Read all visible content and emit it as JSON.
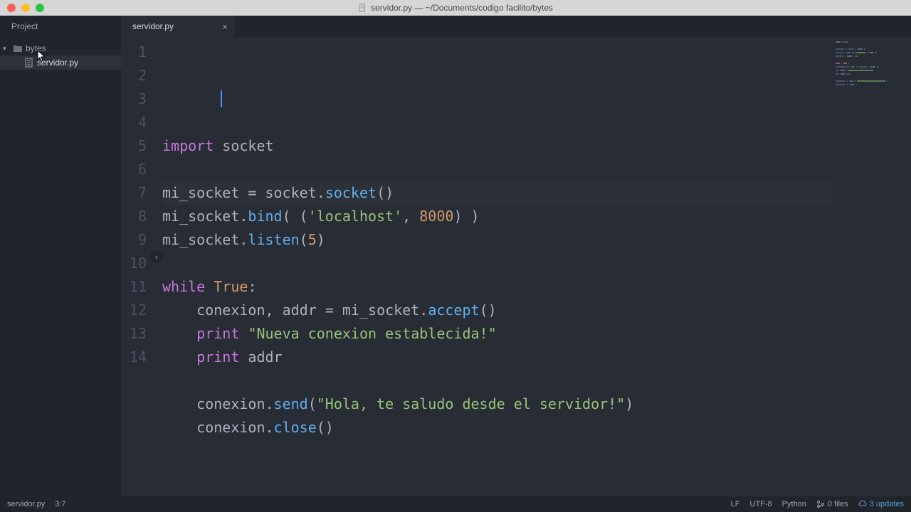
{
  "window": {
    "title": "servidor.py — ~/Documents/codigo facilito/bytes"
  },
  "tabs": {
    "project": "Project",
    "file": "servidor.py"
  },
  "sidebar": {
    "folder": "bytes",
    "file": "servidor.py"
  },
  "code": {
    "lines": [
      {
        "n": 1,
        "tokens": [
          [
            "tk-import",
            "import"
          ],
          [
            "tk-id",
            " socket"
          ]
        ]
      },
      {
        "n": 2,
        "tokens": []
      },
      {
        "n": 3,
        "tokens": [
          [
            "tk-id",
            "mi_socket "
          ],
          [
            "tk-punc",
            "= "
          ],
          [
            "tk-id",
            "socket"
          ],
          [
            "tk-punc",
            "."
          ],
          [
            "tk-fn",
            "socket"
          ],
          [
            "tk-punc",
            "()"
          ]
        ]
      },
      {
        "n": 4,
        "tokens": [
          [
            "tk-id",
            "mi_socket"
          ],
          [
            "tk-punc",
            "."
          ],
          [
            "tk-fn",
            "bind"
          ],
          [
            "tk-punc",
            "( ("
          ],
          [
            "tk-str",
            "'localhost'"
          ],
          [
            "tk-punc",
            ", "
          ],
          [
            "tk-num",
            "8000"
          ],
          [
            "tk-punc",
            ") )"
          ]
        ]
      },
      {
        "n": 5,
        "tokens": [
          [
            "tk-id",
            "mi_socket"
          ],
          [
            "tk-punc",
            "."
          ],
          [
            "tk-fn",
            "listen"
          ],
          [
            "tk-punc",
            "("
          ],
          [
            "tk-num",
            "5"
          ],
          [
            "tk-punc",
            ")"
          ]
        ]
      },
      {
        "n": 6,
        "tokens": []
      },
      {
        "n": 7,
        "tokens": [
          [
            "tk-kw",
            "while"
          ],
          [
            "tk-id",
            " "
          ],
          [
            "tk-const",
            "True"
          ],
          [
            "tk-punc",
            ":"
          ]
        ]
      },
      {
        "n": 8,
        "tokens": [
          [
            "tk-id",
            "    conexion"
          ],
          [
            "tk-punc",
            ", "
          ],
          [
            "tk-id",
            "addr "
          ],
          [
            "tk-punc",
            "= "
          ],
          [
            "tk-id",
            "mi_socket"
          ],
          [
            "tk-punc",
            "."
          ],
          [
            "tk-fn",
            "accept"
          ],
          [
            "tk-punc",
            "()"
          ]
        ]
      },
      {
        "n": 9,
        "tokens": [
          [
            "tk-id",
            "    "
          ],
          [
            "tk-kw",
            "print"
          ],
          [
            "tk-id",
            " "
          ],
          [
            "tk-str",
            "\"Nueva conexion establecida!\""
          ]
        ]
      },
      {
        "n": 10,
        "tokens": [
          [
            "tk-id",
            "    "
          ],
          [
            "tk-kw",
            "print"
          ],
          [
            "tk-id",
            " addr"
          ]
        ]
      },
      {
        "n": 11,
        "tokens": []
      },
      {
        "n": 12,
        "tokens": [
          [
            "tk-id",
            "    conexion"
          ],
          [
            "tk-punc",
            "."
          ],
          [
            "tk-fn",
            "send"
          ],
          [
            "tk-punc",
            "("
          ],
          [
            "tk-str",
            "\"Hola, te saludo desde el servidor!\""
          ],
          [
            "tk-punc",
            ")"
          ]
        ]
      },
      {
        "n": 13,
        "tokens": [
          [
            "tk-id",
            "    conexion"
          ],
          [
            "tk-punc",
            "."
          ],
          [
            "tk-fn",
            "close"
          ],
          [
            "tk-punc",
            "()"
          ]
        ]
      },
      {
        "n": 14,
        "tokens": []
      }
    ]
  },
  "status": {
    "file": "servidor.py",
    "pos": "3:7",
    "lineEnding": "LF",
    "encoding": "UTF-8",
    "lang": "Python",
    "git": "0 files",
    "updates": "3 updates"
  }
}
